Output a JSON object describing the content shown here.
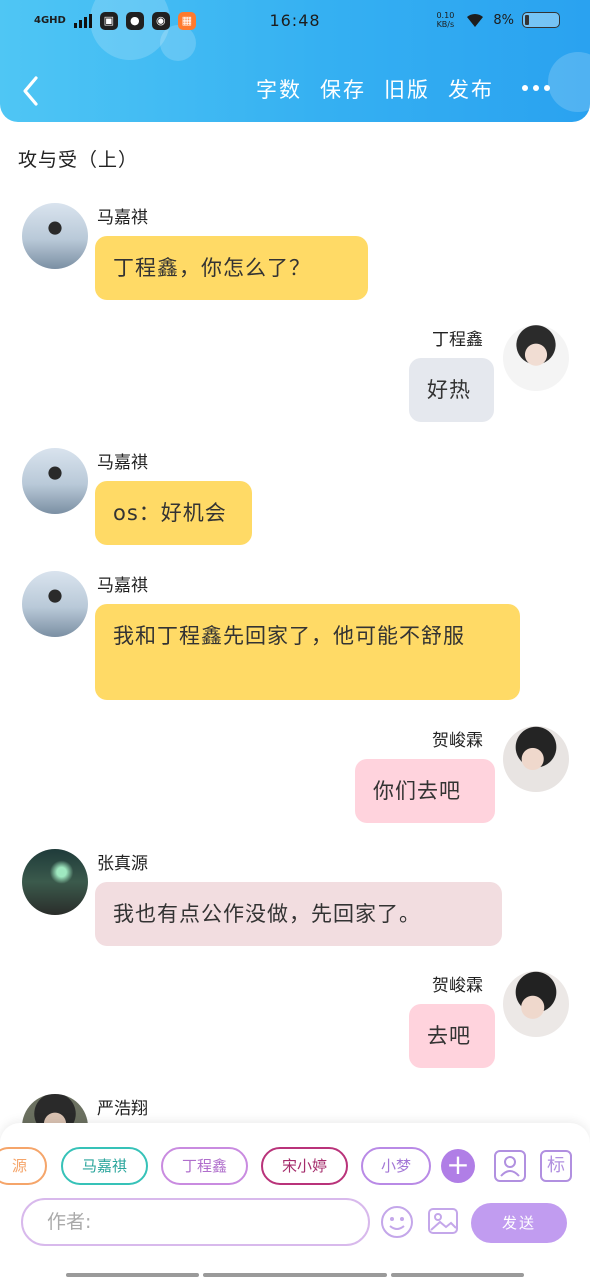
{
  "status_bar": {
    "network": "4GHD",
    "time": "16:48",
    "speed": "0.10 KB/s",
    "battery": "8%"
  },
  "header": {
    "actions": [
      "字数",
      "保存",
      "旧版",
      "发布"
    ],
    "colors": {
      "gradient_start": "#4fc6f4",
      "gradient_end": "#2aa2f0"
    }
  },
  "story_title": "攻与受（上）",
  "messages": [
    {
      "name": "马嘉祺",
      "text": "丁程鑫，你怎么了？",
      "side": "left",
      "bubble_color": "#ffda66"
    },
    {
      "name": "丁程鑫",
      "text": "好热",
      "side": "right",
      "bubble_color": "#e5e8ee"
    },
    {
      "name": "马嘉祺",
      "text": "os：好机会",
      "side": "left",
      "bubble_color": "#ffda66"
    },
    {
      "name": "马嘉祺",
      "text": "我和丁程鑫先回家了，他可能不舒服",
      "side": "left",
      "bubble_color": "#ffda66"
    },
    {
      "name": "贺峻霖",
      "text": "你们去吧",
      "side": "right",
      "bubble_color": "#ffd3dd"
    },
    {
      "name": "张真源",
      "text": "我也有点公作没做，先回家了。",
      "side": "left",
      "bubble_color": "#f2dde0"
    },
    {
      "name": "贺峻霖",
      "text": "去吧",
      "side": "right",
      "bubble_color": "#ffd3dd"
    },
    {
      "name": "严浩翔",
      "text": "",
      "side": "left",
      "bubble_color": ""
    }
  ],
  "character_chips": [
    {
      "label": "源",
      "color": "#f5a56a"
    },
    {
      "label": "马嘉祺",
      "color": "#36c2b8"
    },
    {
      "label": "丁程鑫",
      "color": "#c98be0"
    },
    {
      "label": "宋小婷",
      "color": "#b9337a"
    },
    {
      "label": "小梦",
      "color": "#b98ae6"
    }
  ],
  "input": {
    "placeholder": "作者:"
  },
  "send_label": "发送",
  "label_button": "标",
  "add_button": "+"
}
